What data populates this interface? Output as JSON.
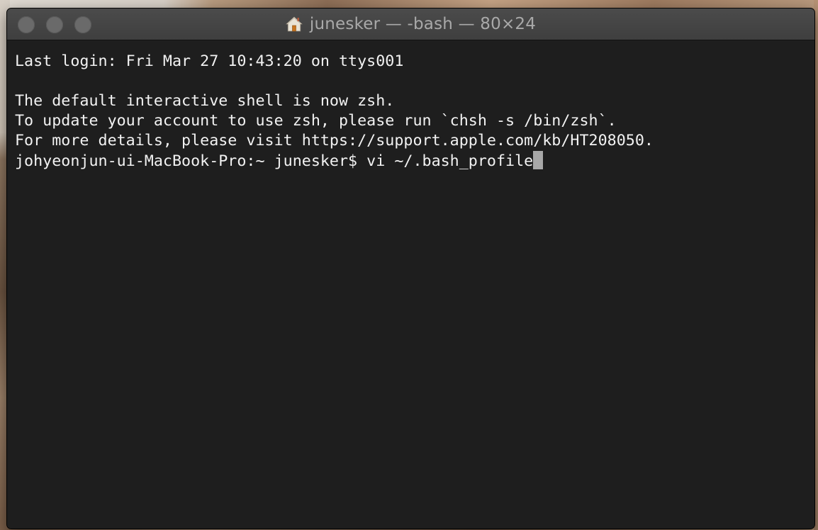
{
  "window": {
    "title": "junesker — -bash — 80×24",
    "title_icon": "home-icon",
    "buttons": [
      "close",
      "minimize",
      "zoom"
    ],
    "colors": {
      "background": "#1e1e1e",
      "text": "#f2f2f2",
      "cursor": "#a8a8a8",
      "titlebar": "#444444",
      "traffic_inactive": "#6a6a6a"
    }
  },
  "terminal": {
    "lines": [
      "Last login: Fri Mar 27 10:43:20 on ttys001",
      "",
      "The default interactive shell is now zsh.",
      "To update your account to use zsh, please run `chsh -s /bin/zsh`.",
      "For more details, please visit https://support.apple.com/kb/HT208050."
    ],
    "prompt": "johyeonjun-ui-MacBook-Pro:~ junesker$ ",
    "command": "vi ~/.bash_profile"
  }
}
